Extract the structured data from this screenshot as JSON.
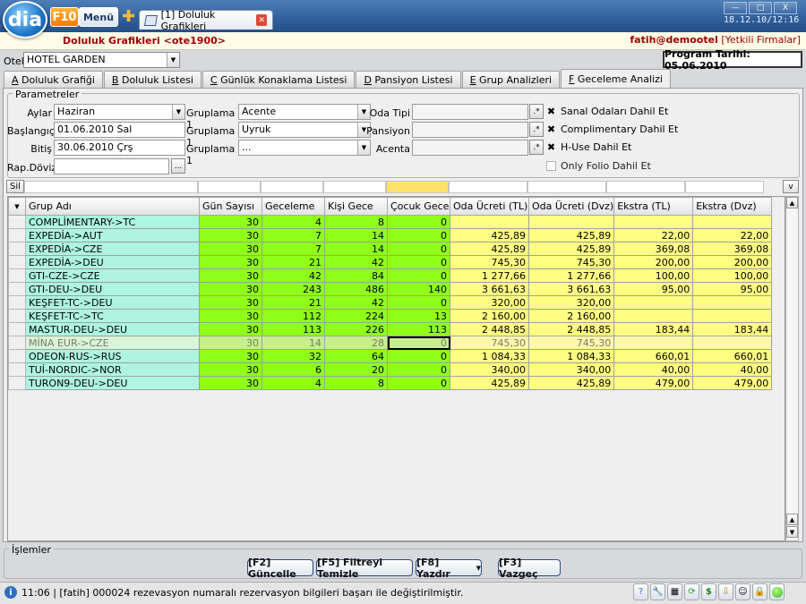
{
  "app": {
    "logo": "dia",
    "f10": "F10",
    "menu": "Menü",
    "doc_tab": "[1] Doluluk Grafikleri",
    "clock": "18.12.10/12:16",
    "win_min": "—",
    "win_max": "□",
    "win_close": "X"
  },
  "header": {
    "form_title": "Doluluk Grafikleri <ote1900>",
    "user": "fatih@demootel",
    "firm": "[Yetkili Firmalar]"
  },
  "otel": {
    "label": "Otel",
    "value": "HOTEL GARDEN"
  },
  "program_date": "Program Tarihi: 05.06.2010",
  "tabs": [
    {
      "key": "A",
      "label": "Doluluk Grafiği"
    },
    {
      "key": "B",
      "label": "Doluluk Listesi"
    },
    {
      "key": "C",
      "label": "Günlük Konaklama Listesi"
    },
    {
      "key": "D",
      "label": "Pansiyon Listesi"
    },
    {
      "key": "E",
      "label": "Grup Analizleri"
    },
    {
      "key": "F",
      "label": "Geceleme Analizi"
    }
  ],
  "params": {
    "title": "Parametreler",
    "aylar_label": "Aylar",
    "aylar": "Haziran",
    "baslangic_label": "Başlangıç",
    "baslangic": "01.06.2010 Sal",
    "bitis_label": "Bitiş",
    "bitis": "30.06.2010 Çrş",
    "rap_dovizi_label": "Rap.Dövizi",
    "rap_dovizi": "",
    "gruplama1_label": "Gruplama 1",
    "gruplama1": "Acente",
    "gruplama2_label": "Gruplama 1",
    "gruplama2": "Uyruk",
    "gruplama3_label": "Gruplama 1",
    "gruplama3": "...",
    "oda_tipi_label": "Oda Tipi",
    "pansiyon_label": "Pansiyon",
    "acenta_label": "Acenta",
    "search_btn": ".*",
    "dots_btn": "...",
    "chk_sanal": "Sanal Odaları Dahil Et",
    "chk_compl": "Complimentary Dahil Et",
    "chk_huse": "H-Use Dahil Et",
    "chk_folio": "Only Folio Dahil Et",
    "checked_mark": "✖"
  },
  "filter": {
    "sil": "Sil",
    "v": "v"
  },
  "grid": {
    "columns": [
      "Grup Adı",
      "Gün Sayısı",
      "Geceleme",
      "Kişi Gece",
      "Çocuk Gece",
      "Oda Ücreti (TL)",
      "Oda Ücreti (Dvz)",
      "Ekstra (TL)",
      "Ekstra (Dvz)"
    ],
    "rows": [
      [
        "COMPLİMENTARY->TC",
        "30",
        "4",
        "8",
        "0",
        "",
        "",
        "",
        ""
      ],
      [
        "EXPEDİA->AUT",
        "30",
        "7",
        "14",
        "0",
        "425,89",
        "425,89",
        "22,00",
        "22,00"
      ],
      [
        "EXPEDİA->CZE",
        "30",
        "7",
        "14",
        "0",
        "425,89",
        "425,89",
        "369,08",
        "369,08"
      ],
      [
        "EXPEDİA->DEU",
        "30",
        "21",
        "42",
        "0",
        "745,30",
        "745,30",
        "200,00",
        "200,00"
      ],
      [
        "GTI-CZE->CZE",
        "30",
        "42",
        "84",
        "0",
        "1 277,66",
        "1 277,66",
        "100,00",
        "100,00"
      ],
      [
        "GTI-DEU->DEU",
        "30",
        "243",
        "486",
        "140",
        "3 661,63",
        "3 661,63",
        "95,00",
        "95,00"
      ],
      [
        "KEŞFET-TC->DEU",
        "30",
        "21",
        "42",
        "0",
        "320,00",
        "320,00",
        "",
        ""
      ],
      [
        "KEŞFET-TC->TC",
        "30",
        "112",
        "224",
        "13",
        "2 160,00",
        "2 160,00",
        "",
        ""
      ],
      [
        "MASTUR-DEU->DEU",
        "30",
        "113",
        "226",
        "113",
        "2 448,85",
        "2 448,85",
        "183,44",
        "183,44"
      ],
      [
        "MİNA EUR->CZE",
        "30",
        "14",
        "28",
        "0",
        "745,30",
        "745,30",
        "",
        ""
      ],
      [
        "ODEON-RUS->RUS",
        "30",
        "32",
        "64",
        "0",
        "1 084,33",
        "1 084,33",
        "660,01",
        "660,01"
      ],
      [
        "TUİ-NORDIC->NOR",
        "30",
        "6",
        "20",
        "0",
        "340,00",
        "340,00",
        "40,00",
        "40,00"
      ],
      [
        "TURON9-DEU->DEU",
        "30",
        "4",
        "8",
        "0",
        "425,89",
        "425,89",
        "479,00",
        "479,00"
      ]
    ]
  },
  "actions": {
    "title": "İşlemler",
    "guncelle": "[F2] Güncelle",
    "filtre": "[F5] Filtreyi Temizle",
    "yazdir": "[F8] Yazdır",
    "vazgec": "[F3] Vazgeç"
  },
  "status": {
    "text": "11:06 | [fatih] 000024 rezevasyon numaralı rezervasyon bilgileri başarı ile değiştirilmiştir."
  }
}
